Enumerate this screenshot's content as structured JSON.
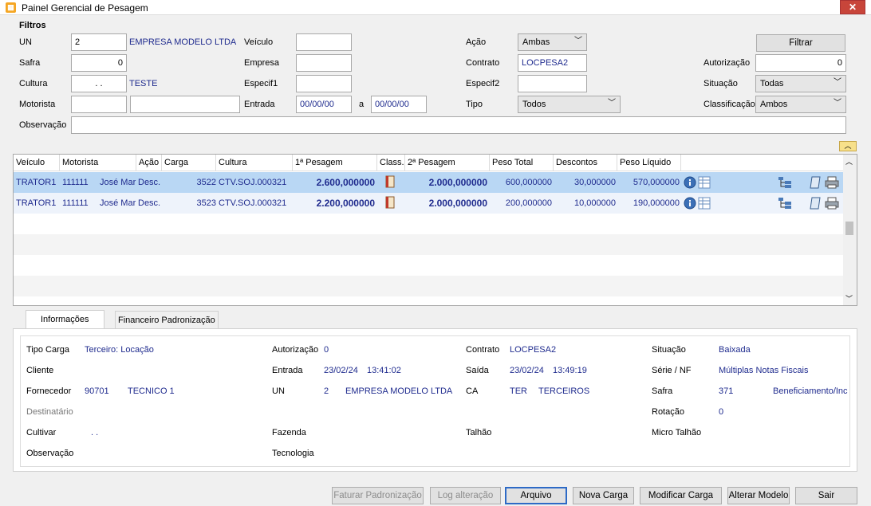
{
  "window": {
    "title": "Painel Gerencial de Pesagem",
    "close": "✕"
  },
  "filters": {
    "section_title": "Filtros",
    "un_label": "UN",
    "un_value": "2",
    "un_name": "EMPRESA MODELO LTDA",
    "safra_label": "Safra",
    "safra_value": "0",
    "cultura_label": "Cultura",
    "cultura_value": ".   .",
    "cultura_name": "TESTE",
    "motorista_label": "Motorista",
    "motorista_value": "",
    "motorista_name": "",
    "observacao_label": "Observação",
    "observacao_value": "",
    "veiculo_label": "Veículo",
    "veiculo_value": "",
    "empresa_label": "Empresa",
    "empresa_value": "",
    "especif1_label": "Especif1",
    "especif1_value": "",
    "entrada_label": "Entrada",
    "entrada_from": "00/00/00",
    "entrada_sep": "a",
    "entrada_to": "00/00/00",
    "acao_label": "Ação",
    "acao_value": "Ambas",
    "contrato_label": "Contrato",
    "contrato_value": "LOCPESA2",
    "especif2_label": "Especif2",
    "especif2_value": "",
    "tipo_label": "Tipo",
    "tipo_value": "Todos",
    "filtrar_button": "Filtrar",
    "autorizacao_label": "Autorização",
    "autorizacao_value": "0",
    "situacao_label": "Situação",
    "situacao_value": "Todas",
    "classificacao_label": "Classificação",
    "classificacao_value": "Ambos"
  },
  "grid": {
    "columns": [
      "Veículo",
      "Motorista",
      "Ação",
      "Carga",
      "Cultura",
      "1ª Pesagem",
      "Class.",
      "2ª Pesagem",
      "Peso Total",
      "Descontos",
      "Peso Líquido"
    ],
    "rows": [
      {
        "veiculo": "TRATOR1",
        "motorista_code": "111111",
        "motorista_name": "José Mar",
        "acao": "Desc.",
        "carga": "3522",
        "cultura": "CTV.SOJ.000321",
        "pesagem1": "2.600,000000",
        "pesagem2": "2.000,000000",
        "peso_total": "600,000000",
        "descontos": "30,000000",
        "peso_liquido": "570,000000"
      },
      {
        "veiculo": "TRATOR1",
        "motorista_code": "111111",
        "motorista_name": "José Mar",
        "acao": "Desc.",
        "carga": "3523",
        "cultura": "CTV.SOJ.000321",
        "pesagem1": "2.200,000000",
        "pesagem2": "2.000,000000",
        "peso_total": "200,000000",
        "descontos": "10,000000",
        "peso_liquido": "190,000000"
      }
    ]
  },
  "tabs": {
    "info": "Informações",
    "financeiro": "Financeiro Padronização"
  },
  "info": {
    "tipo_carga_label": "Tipo Carga",
    "tipo_carga_value": "Terceiro: Locação",
    "cliente_label": "Cliente",
    "fornecedor_label": "Fornecedor",
    "fornecedor_code": "90701",
    "fornecedor_name": "TECNICO 1",
    "destinatario_label": "Destinatário",
    "cultivar_label": "Cultivar",
    "cultivar_value": ".   .",
    "observacao_label": "Observação",
    "autorizacao_label": "Autorização",
    "autorizacao_value": "0",
    "entrada_label": "Entrada",
    "entrada_date": "23/02/24",
    "entrada_time": "13:41:02",
    "un_label": "UN",
    "un_code": "2",
    "un_name": "EMPRESA MODELO LTDA",
    "fazenda_label": "Fazenda",
    "tecnologia_label": "Tecnologia",
    "contrato_label": "Contrato",
    "contrato_value": "LOCPESA2",
    "saida_label": "Saída",
    "saida_date": "23/02/24",
    "saida_time": "13:49:19",
    "ca_label": "CA",
    "ca_code": "TER",
    "ca_name": "TERCEIROS",
    "talhao_label": "Talhão",
    "situacao_label": "Situação",
    "situacao_value": "Baixada",
    "serie_label": "Série / NF",
    "serie_value": "Múltiplas Notas Fiscais",
    "safra_label": "Safra",
    "safra_code": "371",
    "safra_name": "Beneficiamento/Inc",
    "rotacao_label": "Rotação",
    "rotacao_value": "0",
    "micro_talhao_label": "Micro Talhão"
  },
  "buttons": {
    "faturar": "Faturar Padronização",
    "log": "Log alteração",
    "arquivo": "Arquivo",
    "nova_carga": "Nova Carga",
    "modificar_carga": "Modificar Carga",
    "alterar_modelo": "Alterar Modelo",
    "sair": "Sair"
  }
}
